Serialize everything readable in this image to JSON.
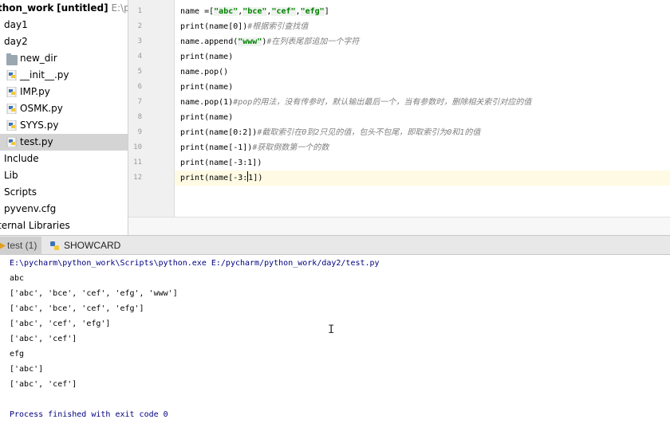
{
  "project_tree": {
    "root_name": "thon_work",
    "root_tag": "[untitled]",
    "root_path": "E:\\pyc",
    "items": [
      {
        "label": "day1",
        "icon": "folder-icon"
      },
      {
        "label": "day2",
        "icon": "folder-icon"
      },
      {
        "label": "new_dir",
        "icon": "folder-icon"
      },
      {
        "label": "__init__.py",
        "icon": "python-file-icon"
      },
      {
        "label": "IMP.py",
        "icon": "python-file-icon"
      },
      {
        "label": "OSMK.py",
        "icon": "python-file-icon"
      },
      {
        "label": "SYYS.py",
        "icon": "python-file-icon"
      },
      {
        "label": "test.py",
        "icon": "python-file-icon",
        "selected": true
      },
      {
        "label": "Include",
        "icon": "folder-icon"
      },
      {
        "label": "Lib",
        "icon": "folder-icon"
      },
      {
        "label": "Scripts",
        "icon": "folder-icon"
      },
      {
        "label": "pyvenv.cfg",
        "icon": "file-icon"
      },
      {
        "label": "ternal Libraries",
        "icon": "library-icon"
      }
    ]
  },
  "editor": {
    "line_numbers": [
      "1",
      "2",
      "3",
      "4",
      "5",
      "6",
      "7",
      "8",
      "9",
      "10",
      "11",
      "12"
    ],
    "lines": [
      {
        "code": "name =[",
        "s1": "\"abc\"",
        "c1": ",",
        "s2": "\"bce\"",
        "c2": ",",
        "s3": "\"cef\"",
        "c3": ",",
        "s4": "\"efg\"",
        "tail": "]"
      },
      {
        "code": "print(name[0])",
        "comment": "#根据索引查找值"
      },
      {
        "code": "name.append(",
        "str": "\"www\"",
        "code2": ")",
        "comment": "#在列表尾部追加一个字符"
      },
      {
        "code": "print(name)"
      },
      {
        "code": "name.pop()"
      },
      {
        "code": "print(name)"
      },
      {
        "code": "name.pop(1)",
        "comment": "#pop的用法，没有传参时，默认输出最后一个，当有参数时，删除相关索引对应的值"
      },
      {
        "code": "print(name)"
      },
      {
        "code": "print(name[0:2])",
        "comment": "#截取索引在0到2只见的值，包头不包尾，即取索引为0和1的值"
      },
      {
        "code": "print(name[-1])",
        "comment": "#获取倒数第一个的数"
      },
      {
        "code": "print(name[-3:1])"
      },
      {
        "code": "print(name[-3:",
        "code_after_caret": "1])"
      }
    ]
  },
  "tool_tabs": [
    {
      "label": "test (1)",
      "icon": "run-icon",
      "active": true
    },
    {
      "label": "SHOWCARD",
      "icon": "python-icon",
      "active": false
    }
  ],
  "console": {
    "command": "E:\\pycharm\\python_work\\Scripts\\python.exe E:/pycharm/python_work/day2/test.py",
    "output": [
      "abc",
      "['abc', 'bce', 'cef', 'efg', 'www']",
      "['abc', 'bce', 'cef', 'efg']",
      "['abc', 'cef', 'efg']",
      "['abc', 'cef']",
      "efg",
      "['abc']",
      "['abc', 'cef']"
    ],
    "exit_message": "Process finished with exit code 0"
  },
  "colors": {
    "string": "#008000",
    "comment": "#808080",
    "console_system": "#000080",
    "selection": "#d4d4d4",
    "current_line": "#fffae3"
  }
}
